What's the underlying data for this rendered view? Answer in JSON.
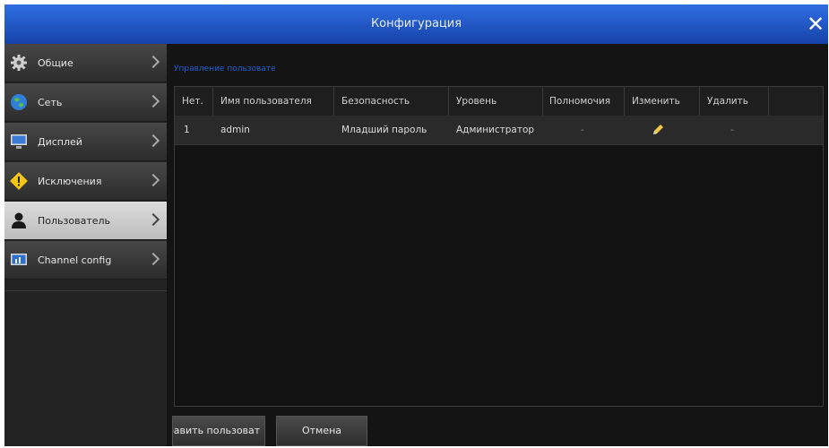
{
  "window": {
    "title": "Конфигурация",
    "close": "✕"
  },
  "sidebar": {
    "items": [
      {
        "label": "Общие",
        "icon": "gear-icon"
      },
      {
        "label": "Сеть",
        "icon": "globe-icon"
      },
      {
        "label": "Дисплей",
        "icon": "monitor-icon"
      },
      {
        "label": "Исключения",
        "icon": "warning-icon"
      },
      {
        "label": "Пользователь",
        "icon": "user-icon",
        "active": true
      },
      {
        "label": "Channel config",
        "icon": "channel-icon"
      }
    ]
  },
  "main": {
    "section_title": "Управление пользовате",
    "table": {
      "headers": [
        "Нет.",
        "Имя пользователя",
        "Безопасность",
        "Уровень",
        "Полномочия",
        "Изменить",
        "Удалить"
      ],
      "rows": [
        {
          "no": "1",
          "username": "admin",
          "security": "Младший пароль",
          "level": "Администратор",
          "permissions": "-",
          "edit_icon": "pencil-icon",
          "delete": "-"
        }
      ]
    },
    "buttons": {
      "add_user": "бавить пользоват",
      "cancel": "Отмена"
    }
  },
  "colors": {
    "titlebar": "#1f55c4",
    "accent_text": "#1f5fd1",
    "edit_icon": "#f2c84b"
  }
}
